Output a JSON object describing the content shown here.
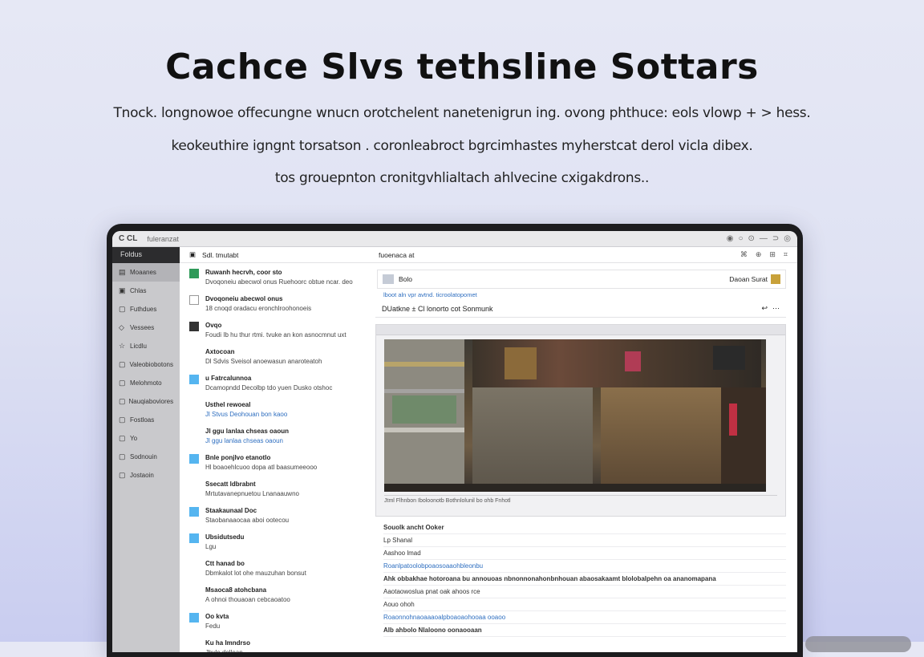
{
  "hero": {
    "title": "Cachce Slvs tethsline Sottars",
    "line1": "Tnock. longnowoe offecungne wnucn orotchelent nanetenigrun ing. ovong phthuce: eols vlowp + > hess.",
    "line2": "keokeuthire igngnt torsatson . coronleabroct bgrcimhastes myherstcat derol vicla dibex.",
    "line3": "tos grouepnton cronitgvhlialtach ahlvecine cxigakdrons.."
  },
  "window": {
    "brand": "C CL",
    "url": "fuleranzat",
    "controls": [
      "◉",
      "○",
      "⊙",
      "—",
      "⊃",
      "◎"
    ]
  },
  "sidebar": {
    "header": "Foldus",
    "items": [
      {
        "label": "Moaanes",
        "icon": "inbox-icon",
        "glyph": "▤"
      },
      {
        "label": "Chlas",
        "icon": "folder-icon",
        "glyph": "▣"
      },
      {
        "label": "Futhdues",
        "icon": "folder-icon",
        "glyph": "▢"
      },
      {
        "label": "Vessees",
        "icon": "tag-icon",
        "glyph": "◇"
      },
      {
        "label": "Licdlu",
        "icon": "star-icon",
        "glyph": "☆"
      },
      {
        "label": "Valeobiobotons",
        "icon": "folder-icon",
        "glyph": "▢"
      },
      {
        "label": "Melohmoto",
        "icon": "folder-icon",
        "glyph": "▢"
      },
      {
        "label": "Nauqiaboviores",
        "icon": "folder-icon",
        "glyph": "▢"
      },
      {
        "label": "Fostloas",
        "icon": "folder-icon",
        "glyph": "▢"
      },
      {
        "label": "Yo",
        "icon": "folder-icon",
        "glyph": "▢"
      },
      {
        "label": "Sodnouin",
        "icon": "folder-icon",
        "glyph": "▢"
      },
      {
        "label": "Jostaoin",
        "icon": "folder-icon",
        "glyph": "▢"
      }
    ]
  },
  "list": {
    "header": "Sdl. tmutabt",
    "rows": [
      {
        "mark": "green",
        "title": "Ruwanh hecrvh, coor sto",
        "sub": "Dvoqoneiu abecwol onus Ruehoorc obtue ncar. deo"
      },
      {
        "mark": "box",
        "title": "Dvoqoneiu abecwol onus",
        "sub": "18 cnoqd oradacu eronchlroohonoeis"
      },
      {
        "mark": "dark",
        "title": "Ovqo",
        "sub": "Foudi Ib hu thur rtmi. tvuke an kon asnocmnut uxt"
      },
      {
        "mark": "none",
        "title": "Axtocoan",
        "sub": "Dl Sdvis Sveisol anoewasun anaroteatoh"
      },
      {
        "mark": "blue",
        "title": "u Fatrcalunnoa",
        "sub": "Dcamopndd Decolbp tdo yuen Dusko otshoc"
      },
      {
        "mark": "none",
        "title": "Usthel rewoeal",
        "sub": "Jl Stvus Deohouan bon kaoo",
        "blue": true
      },
      {
        "mark": "none",
        "title": "Jl ggu lanlaa chseas oaoun",
        "sub": "Jl ggu lanlaa chseas oaoun",
        "blue": true
      },
      {
        "mark": "blue",
        "title": "Bnle ponjlvo etanotlo",
        "sub": "Hl boaoehlcuoo dopa atl baasumeeooo"
      },
      {
        "mark": "none",
        "title": "Ssecatt ldbrabnt",
        "sub": "Mrtutavanepnuetou Lnanaauwno"
      },
      {
        "mark": "blue",
        "title": "Staakaunaal Doc",
        "sub": "Staobanaaocaa aboi ootecou"
      },
      {
        "mark": "blue",
        "title": "Ubsidutsedu",
        "sub": "Lgu"
      },
      {
        "mark": "none",
        "title": "Ctt hanad bo",
        "sub": "Dbmkalot lot ohe mauzuhan bonsut"
      },
      {
        "mark": "none",
        "title": "Msaoca8 atohcbana",
        "sub": "A ohnoi thouaoan cebcaoatoo"
      },
      {
        "mark": "blue",
        "title": "Oo kvta",
        "sub": "Fedu"
      },
      {
        "mark": "none",
        "title": "Ku ha Imndrso",
        "sub": "Jhvle dollean"
      }
    ]
  },
  "detail": {
    "toolbar_title": "fuoenaca at",
    "toolbar_icons": [
      "⌘",
      "⊕",
      "⊞",
      "⌗"
    ],
    "sender": "Bolo",
    "sender_link": "lboot aln vpr avtnd. ticroolatopomet",
    "meta": "Daoan Surat",
    "subject": "DUatkne ± Cl lonorto cot Sonmunk",
    "caption": "Jtml   Flhnbon   Iboloonotb   Bothnlolunil   bo ohb   Fnhotl",
    "lines": [
      {
        "text": "Souolk ancht Ooker",
        "style": "b"
      },
      {
        "text": "Lp Shanal",
        "style": ""
      },
      {
        "text": "Aashoo lmad",
        "style": ""
      },
      {
        "text": "Roanlpatoolobpoaosoaaohbleonbu",
        "style": "lnk"
      },
      {
        "text": "Ahk obbakhae hotoroana bu annouoas nbnonnonahonbnhouan abaosakaamt blolobalpehn oa ananomapana",
        "style": "b"
      },
      {
        "text": "Aaotaowoslua pnat oak ahoos rce",
        "style": ""
      },
      {
        "text": "Aouo ohoh",
        "style": ""
      },
      {
        "text": "Roaonnohnaoaaaoalpboaoaohooaa ooaoo",
        "style": "lnk"
      },
      {
        "text": "Alb ahbolo Nlaloono oonaooaan",
        "style": "b"
      }
    ]
  },
  "colors": {
    "accent_blue": "#55b5f0",
    "accent_green": "#2f9a59",
    "link": "#2f6fc0"
  }
}
